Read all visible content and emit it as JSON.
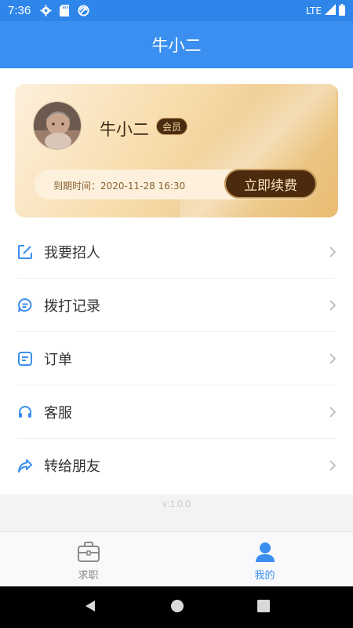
{
  "status_bar": {
    "time": "7:36",
    "network": "LTE",
    "icons": [
      "gear-icon",
      "sd-card-icon",
      "no-disturb-icon",
      "signal-icon",
      "battery-icon"
    ]
  },
  "app_bar": {
    "title": "牛小二"
  },
  "profile_card": {
    "user_name": "牛小二",
    "badge": "会员",
    "expire_text": "到期时间：2020-11-28 16:30",
    "renew_label": "立即续费"
  },
  "menu": {
    "items": [
      {
        "label": "我要招人",
        "icon": "edit-icon"
      },
      {
        "label": "拨打记录",
        "icon": "chat-icon"
      },
      {
        "label": "订单",
        "icon": "order-icon"
      },
      {
        "label": "客服",
        "icon": "headset-icon"
      },
      {
        "label": "转给朋友",
        "icon": "share-icon"
      }
    ]
  },
  "version": "v:1.0.0",
  "tabs": [
    {
      "label": "求职",
      "icon": "briefcase-icon",
      "active": false
    },
    {
      "label": "我的",
      "icon": "person-icon",
      "active": true
    }
  ],
  "colors": {
    "primary": "#3a8ff0",
    "gold": "#e9bd72",
    "dark_brown": "#4b2a0d",
    "inactive": "#888888"
  }
}
